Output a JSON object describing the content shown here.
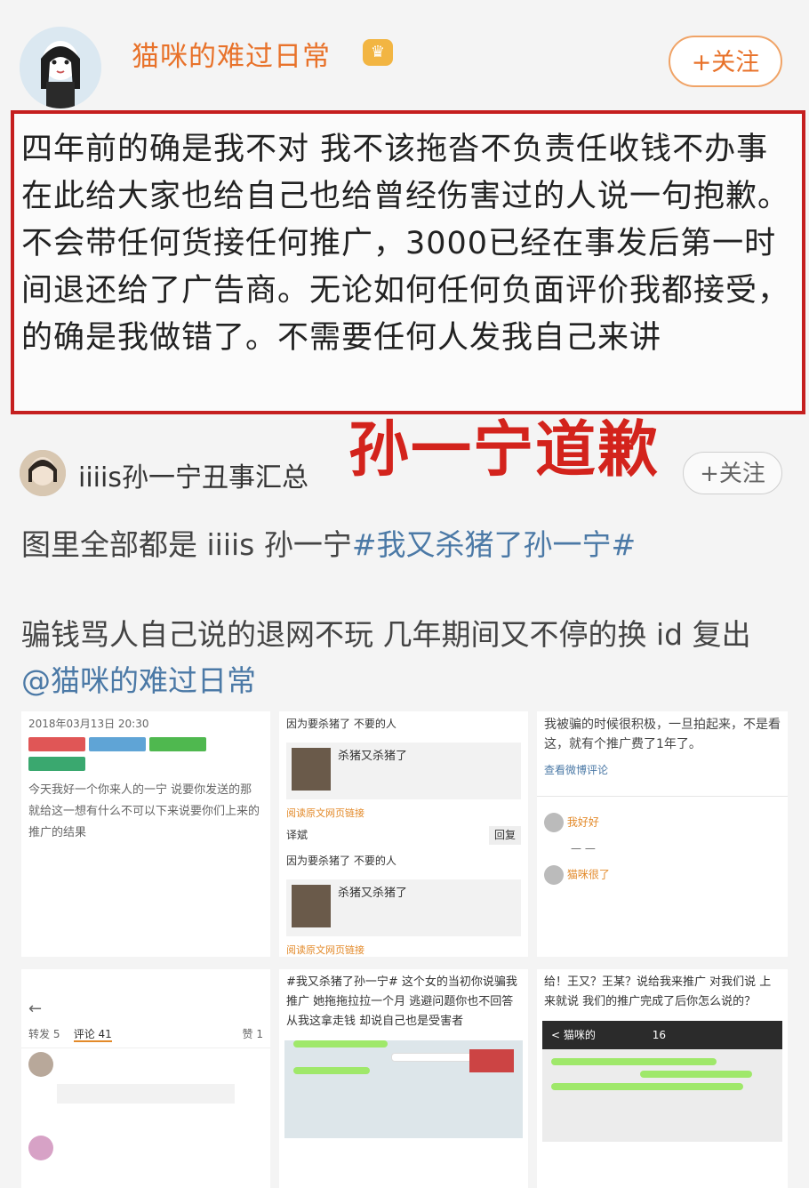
{
  "post1": {
    "username": "猫咪的难过日常",
    "vip_badge": "♛",
    "follow_label": "+关注",
    "text": "四年前的确是我不对 我不该拖沓不负责任收钱不办事 在此给大家也给自己也给曾经伤害过的人说一句抱歉。 不会带任何货接任何推广，3000已经在事发后第一时间退还给了广告商。无论如何任何负面评价我都接受，的确是我做错了。不需要任何人发我自己来讲"
  },
  "headline": "孙一宁道歉",
  "post2": {
    "username": "iiiis孙一宁丑事汇总",
    "follow_label": "+关注",
    "line1_text": "图里全部都是 iiiis 孙一宁",
    "line1_tag": "#我又杀猪了孙一宁#",
    "line2_text": "骗钱骂人自己说的退网不玩 几年期间又不停的换 id 复出",
    "line2_mention": "@猫咪的难过日常"
  },
  "thumbnails": {
    "t1_date": "2018年03月13日 20:30",
    "t1_text": "今天我好一个你来人的一宁 说要你发送的那 就给这一想有什么不可以下来说要你们上来的推广的结果",
    "t2_row1": "因为要杀猪了 不要的人",
    "t2_card_title": "杀猪又杀猪了",
    "t2_link": "阅读原文网页链接",
    "t2_user": "译斌",
    "t2_reply": "回复",
    "t3_text": "我被骗的时候很积极，一旦拍起来，不是看这，就有个推广费了1年了。",
    "t3_link": "查看微博评论",
    "t3_user1": "我好好",
    "t3_user2": "猫咪很了",
    "t4_tab1": "转发 5",
    "t4_tab2": "评论 41",
    "t4_tab3": "赞 1",
    "t5_text": "#我又杀猪了孙一宁# 这个女的当初你说骗我推广 她拖拖拉拉一个月 逃避问题你也不回答 从我这拿走钱 却说自己也是受害者",
    "t6_text": "给！王又？王某？说给我来推广 对我们说 上来就说 我们的推广完成了后你怎么说的？",
    "t6_chat_title": "< 猫咪的",
    "t6_chat_num": "16"
  },
  "colors": {
    "accent": "#e8722a",
    "link": "#4b79a6",
    "alert_red": "#d3231c",
    "box_border": "#c51f1f"
  }
}
